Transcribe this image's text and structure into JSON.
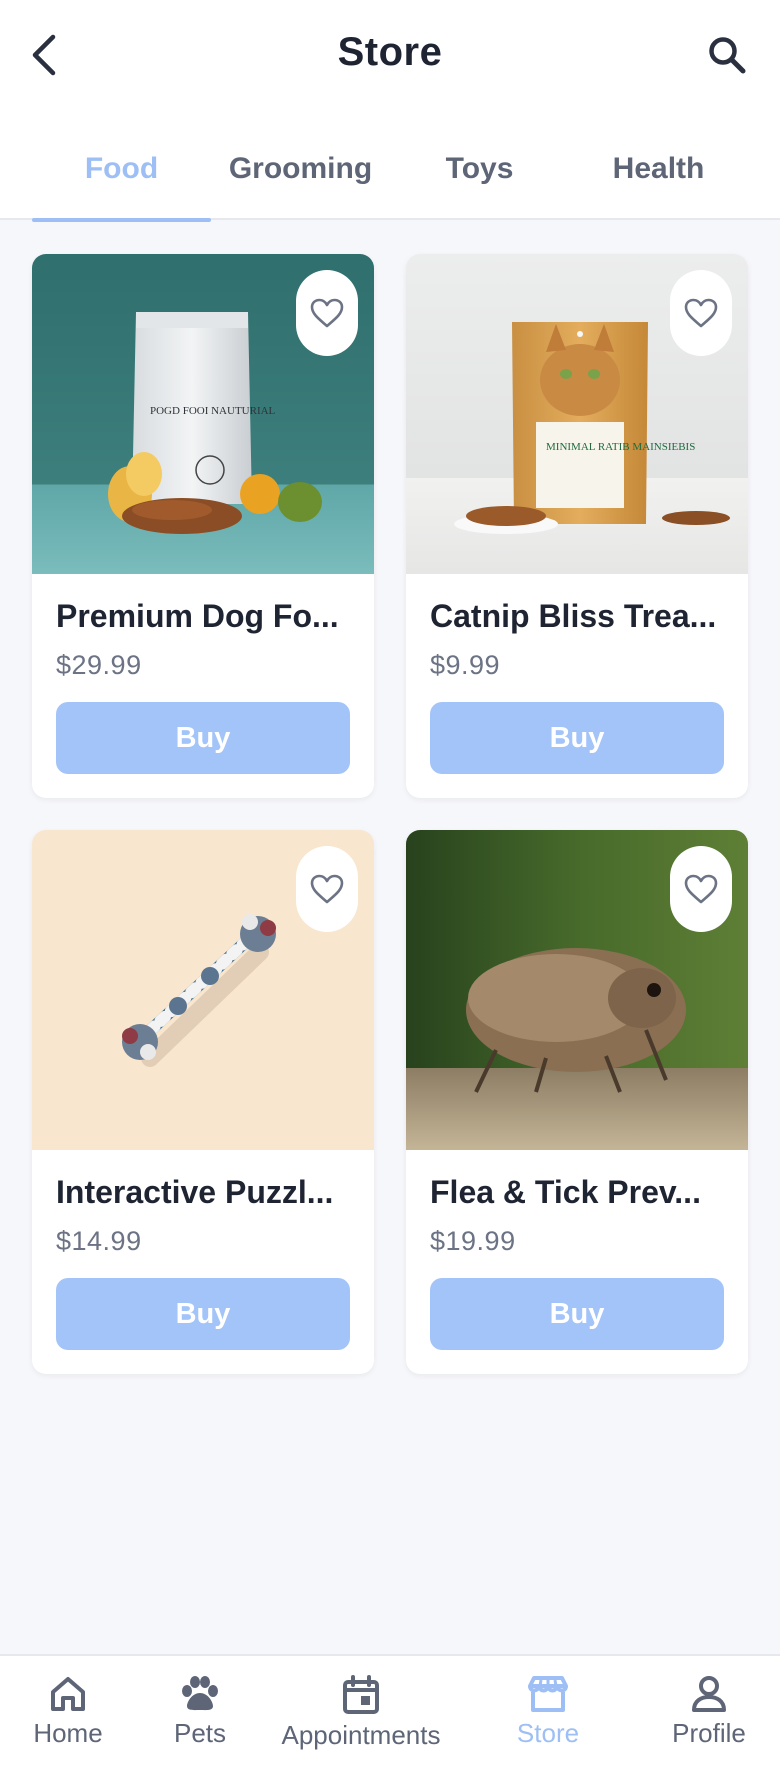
{
  "header": {
    "title": "Store",
    "back_icon": "chevron-left-icon",
    "search_icon": "search-icon"
  },
  "tabs": [
    {
      "label": "Food",
      "active": true
    },
    {
      "label": "Grooming",
      "active": false
    },
    {
      "label": "Toys",
      "active": false
    },
    {
      "label": "Health",
      "active": false
    }
  ],
  "products": [
    {
      "name": "Premium Dog Fo...",
      "price": "$29.99",
      "buy_label": "Buy",
      "image": "dog-food-bag-image",
      "package_text": "POGD FOOI NAUTURIAL"
    },
    {
      "name": "Catnip Bliss Trea...",
      "price": "$9.99",
      "buy_label": "Buy",
      "image": "cat-treats-bag-image",
      "package_text": "MINIMAL RATIB MAINSIEBIS"
    },
    {
      "name": "Interactive Puzzl...",
      "price": "$14.99",
      "buy_label": "Buy",
      "image": "rope-toy-image",
      "package_text": ""
    },
    {
      "name": "Flea & Tick Prev...",
      "price": "$19.99",
      "buy_label": "Buy",
      "image": "insect-image",
      "package_text": ""
    }
  ],
  "bottom_nav": [
    {
      "label": "Home",
      "icon": "home-icon",
      "active": false
    },
    {
      "label": "Pets",
      "icon": "paw-icon",
      "active": false
    },
    {
      "label": "Appointments",
      "icon": "calendar-icon",
      "active": false
    },
    {
      "label": "Store",
      "icon": "store-icon",
      "active": true
    },
    {
      "label": "Profile",
      "icon": "person-icon",
      "active": false
    }
  ],
  "colors": {
    "accent": "#9dbff5",
    "button": "#a3c4f8",
    "text_dark": "#1f2433",
    "text_muted": "#5d6577",
    "background": "#f6f7fa"
  }
}
